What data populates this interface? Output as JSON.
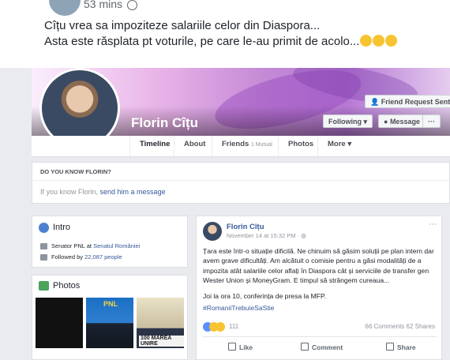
{
  "post": {
    "time": "53 mins",
    "line1": "Cîțu vrea sa impoziteze salariile celor din Diaspora...",
    "line2": "Asta este răsplata pt voturile, pe care le-au primit de acolo..."
  },
  "profile": {
    "name": "Florin Cîțu",
    "friend_request": "Friend Request Sent",
    "following": "Following ▾",
    "message": "Message",
    "more": "···"
  },
  "tabs": [
    {
      "label": "Timeline"
    },
    {
      "label": "About"
    },
    {
      "label": "Friends",
      "sub": "1 Mutual"
    },
    {
      "label": "Photos"
    },
    {
      "label": "More ▾"
    }
  ],
  "know": {
    "title": "DO YOU KNOW FLORIN?",
    "text": "If you know Florin, ",
    "link": "send him a message"
  },
  "intro": {
    "title": "Intro",
    "row1_prefix": "Senator PNL at ",
    "row1_link": "Senatul României",
    "row2_prefix": "Followed by ",
    "row2_link": "22,087 people"
  },
  "photos": {
    "title": "Photos",
    "p2_label": "PNL",
    "p3_label": "100 MAREA UNIRE"
  },
  "feed": {
    "name": "Florin Cîțu",
    "date": "November 14 at 15:32 PM · ",
    "body": "Țara este într-o situație dificilă. Ne chinuim să găsim soluții pe plan intern dar avem grave dificultăți. Am alcătuit o comisie pentru a găsi modalități de a impozita atât salariile celor aflați în Diaspora cât și serviciile de transfer gen Wester Union și MoneyGram. E timpul să strângem cureaua...",
    "body2": "Joi la ora 10, conferința de presa la MFP.",
    "tag": "#RomaniiTrebuieSaStie",
    "reactions": "111",
    "stats": "66 Comments  62 Shares",
    "like": "Like",
    "comment": "Comment",
    "share": "Share"
  }
}
